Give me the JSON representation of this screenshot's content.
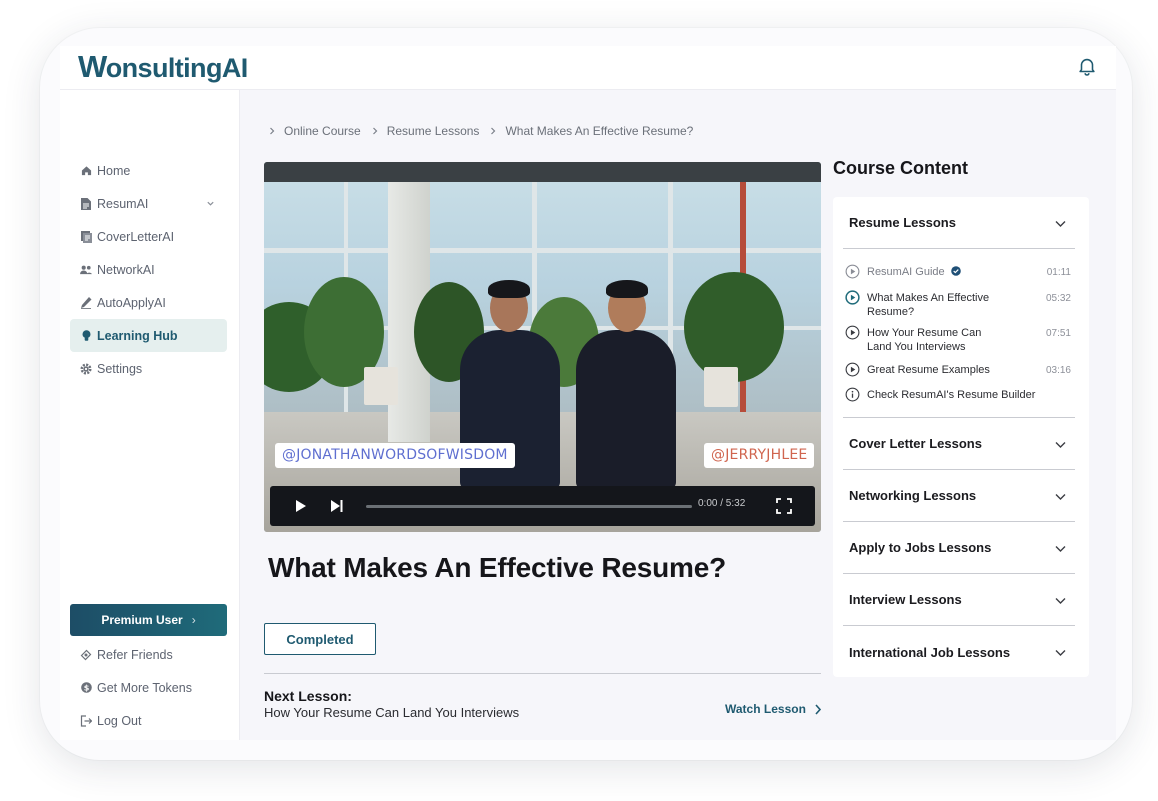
{
  "app": {
    "logo_text": "WonsultingAI",
    "logo_first": "W",
    "logo_rest": "onsultingAI"
  },
  "sidebar": {
    "items": [
      {
        "label": "Home",
        "icon": "home-icon"
      },
      {
        "label": "ResumAI",
        "icon": "document-icon",
        "has_dropdown": true
      },
      {
        "label": "CoverLetterAI",
        "icon": "cover-letter-icon"
      },
      {
        "label": "NetworkAI",
        "icon": "people-icon"
      },
      {
        "label": "AutoApplyAI",
        "icon": "pen-icon"
      },
      {
        "label": "Learning Hub",
        "icon": "lightbulb-icon",
        "active": true
      },
      {
        "label": "Settings",
        "icon": "gear-icon"
      }
    ],
    "premium_label": "Premium User",
    "bottom_items": [
      {
        "label": "Refer Friends",
        "icon": "ticket-icon"
      },
      {
        "label": "Get More Tokens",
        "icon": "coin-icon"
      },
      {
        "label": "Log Out",
        "icon": "logout-icon"
      }
    ]
  },
  "breadcrumbs": [
    "Online Course",
    "Resume Lessons",
    "What Makes An Effective Resume?"
  ],
  "video": {
    "tag_left": "@JONATHANWORDSOFWISDOM",
    "tag_right": "@JERRYJHLEE",
    "time": "0:00 / 5:32",
    "progress": 0
  },
  "lesson": {
    "title": "What Makes An Effective Resume?",
    "completed_label": "Completed",
    "next_label": "Next Lesson:",
    "next_title": "How Your Resume Can Land You Interviews",
    "watch_label": "Watch Lesson"
  },
  "course": {
    "title": "Course Content",
    "open_section": "Resume Lessons",
    "lessons": [
      {
        "title": "ResumAI Guide",
        "duration": "01:11",
        "verified": true,
        "state": "done"
      },
      {
        "title": "What Makes An Effective Resume?",
        "duration": "05:32",
        "state": "current"
      },
      {
        "title": "How Your Resume Can Land You Interviews",
        "duration": "07:51",
        "state": "todo"
      },
      {
        "title": "Great Resume Examples",
        "duration": "03:16",
        "state": "todo"
      },
      {
        "title": "Check ResumAI's Resume Builder",
        "duration": "",
        "state": "info"
      }
    ],
    "sections": [
      "Cover Letter Lessons",
      "Networking Lessons",
      "Apply to Jobs Lessons",
      "Interview Lessons",
      "International Job Lessons"
    ]
  },
  "colors": {
    "brand": "#1f5a70",
    "active_bg": "#e5efee"
  }
}
